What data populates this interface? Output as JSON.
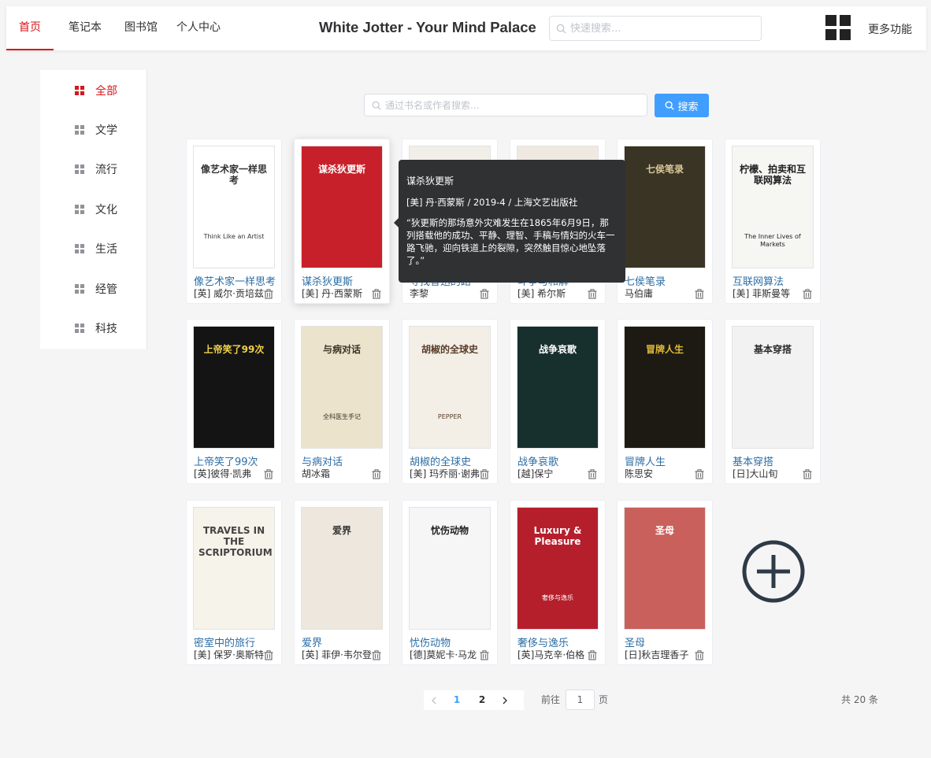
{
  "nav": {
    "items": [
      {
        "label": "首页",
        "active": true
      },
      {
        "label": "笔记本",
        "active": false
      },
      {
        "label": "图书馆",
        "active": false
      },
      {
        "label": "个人中心",
        "active": false
      }
    ]
  },
  "header": {
    "title": "White Jotter - Your Mind Palace",
    "search_placeholder": "快速搜索...",
    "more_label": "更多功能"
  },
  "sidebar": {
    "items": [
      {
        "label": "全部",
        "active": true
      },
      {
        "label": "文学",
        "active": false
      },
      {
        "label": "流行",
        "active": false
      },
      {
        "label": "文化",
        "active": false
      },
      {
        "label": "生活",
        "active": false
      },
      {
        "label": "经管",
        "active": false
      },
      {
        "label": "科技",
        "active": false
      }
    ]
  },
  "book_search": {
    "placeholder": "通过书名或作者搜索...",
    "button_label": "搜索"
  },
  "books": [
    {
      "title": "像艺术家一样思考",
      "author": "[英] 威尔·贡培兹",
      "cover_text": "像艺术家一样思考",
      "cover_sub": "Think Like an Artist",
      "bg": "#ffffff",
      "fg": "#333333"
    },
    {
      "title": "谋杀狄更斯",
      "author": "[美] 丹·西蒙斯",
      "cover_text": "谋杀狄更斯",
      "cover_sub": "",
      "bg": "#c8202a",
      "fg": "#ffffff"
    },
    {
      "title": "寻找鲁迅的路",
      "author": "李黎",
      "cover_text": "",
      "cover_sub": "",
      "bg": "#f2eee8",
      "fg": "#8a2a2a"
    },
    {
      "title": "斗争与和解",
      "author": "[美] 希尔斯",
      "cover_text": "",
      "cover_sub": "",
      "bg": "#efe9e2",
      "fg": "#6b3a24"
    },
    {
      "title": "七侯笔录",
      "author": "马伯庸",
      "cover_text": "七侯笔录",
      "cover_sub": "",
      "bg": "#3a3424",
      "fg": "#d8c79a"
    },
    {
      "title": "互联网算法",
      "author": "[美] 菲斯曼等",
      "cover_text": "柠檬、拍卖和互联网算法",
      "cover_sub": "The Inner Lives of Markets",
      "bg": "#f6f6f3",
      "fg": "#222222"
    },
    {
      "title": "上帝笑了99次",
      "author": "[英]彼得·凯弗",
      "cover_text": "上帝笑了99次",
      "cover_sub": "",
      "bg": "#141414",
      "fg": "#f2d24a"
    },
    {
      "title": "与病对话",
      "author": "胡冰霜",
      "cover_text": "与病对话",
      "cover_sub": "全科医生手记",
      "bg": "#ece3cd",
      "fg": "#3a3326"
    },
    {
      "title": "胡椒的全球史",
      "author": "[美] 玛乔丽·谢弗",
      "cover_text": "胡椒的全球史",
      "cover_sub": "PEPPER",
      "bg": "#f3efe6",
      "fg": "#5a3c2a"
    },
    {
      "title": "战争哀歌",
      "author": "[越]保宁",
      "cover_text": "战争哀歌",
      "cover_sub": "",
      "bg": "#17302e",
      "fg": "#ffffff"
    },
    {
      "title": "冒牌人生",
      "author": "陈思安",
      "cover_text": "冒牌人生",
      "cover_sub": "",
      "bg": "#1c1a12",
      "fg": "#e0b93a"
    },
    {
      "title": "基本穿搭",
      "author": "[日]大山旬",
      "cover_text": "基本穿搭",
      "cover_sub": "",
      "bg": "#f2f2f2",
      "fg": "#2a2a2a"
    },
    {
      "title": "密室中的旅行",
      "author": "[美] 保罗·奥斯特",
      "cover_text": "TRAVELS IN THE SCRIPTORIUM",
      "cover_sub": "",
      "bg": "#f6f3ea",
      "fg": "#444444"
    },
    {
      "title": "爱界",
      "author": "[英] 菲伊·韦尔登",
      "cover_text": "爱界",
      "cover_sub": "",
      "bg": "#ede7dd",
      "fg": "#333333"
    },
    {
      "title": "忧伤动物",
      "author": "[德]莫妮卡·马龙",
      "cover_text": "忧伤动物",
      "cover_sub": "",
      "bg": "#f6f6f6",
      "fg": "#222222"
    },
    {
      "title": "奢侈与逸乐",
      "author": "[英]马克辛·伯格",
      "cover_text": "Luxury & Pleasure",
      "cover_sub": "奢侈与逸乐",
      "bg": "#b51f2c",
      "fg": "#ffffff"
    },
    {
      "title": "圣母",
      "author": "[日]秋吉理香子",
      "cover_text": "圣母",
      "cover_sub": "",
      "bg": "#c9605c",
      "fg": "#ffffff"
    }
  ],
  "tooltip": {
    "title": "谋杀狄更斯",
    "meta": "[美] 丹·西蒙斯 / 2019-4 / 上海文艺出版社",
    "description": "“狄更斯的那场意外灾难发生在1865年6月9日，那列搭载他的成功、平静、理智、手稿与情妇的火车一路飞驰，迎向铁道上的裂隙，突然触目惊心地坠落了。”"
  },
  "pagination": {
    "pages": [
      "1",
      "2"
    ],
    "current": "1",
    "goto_label": "前往",
    "goto_value": "1",
    "goto_unit": "页",
    "total_label": "共 20 条"
  },
  "colors": {
    "accent": "#d9161b",
    "primary": "#409eff",
    "link": "#2c6ea6"
  },
  "icons": {
    "trash": "trash-icon",
    "add": "plus-circle-icon",
    "search": "search-icon",
    "grid": "grid-icon"
  }
}
